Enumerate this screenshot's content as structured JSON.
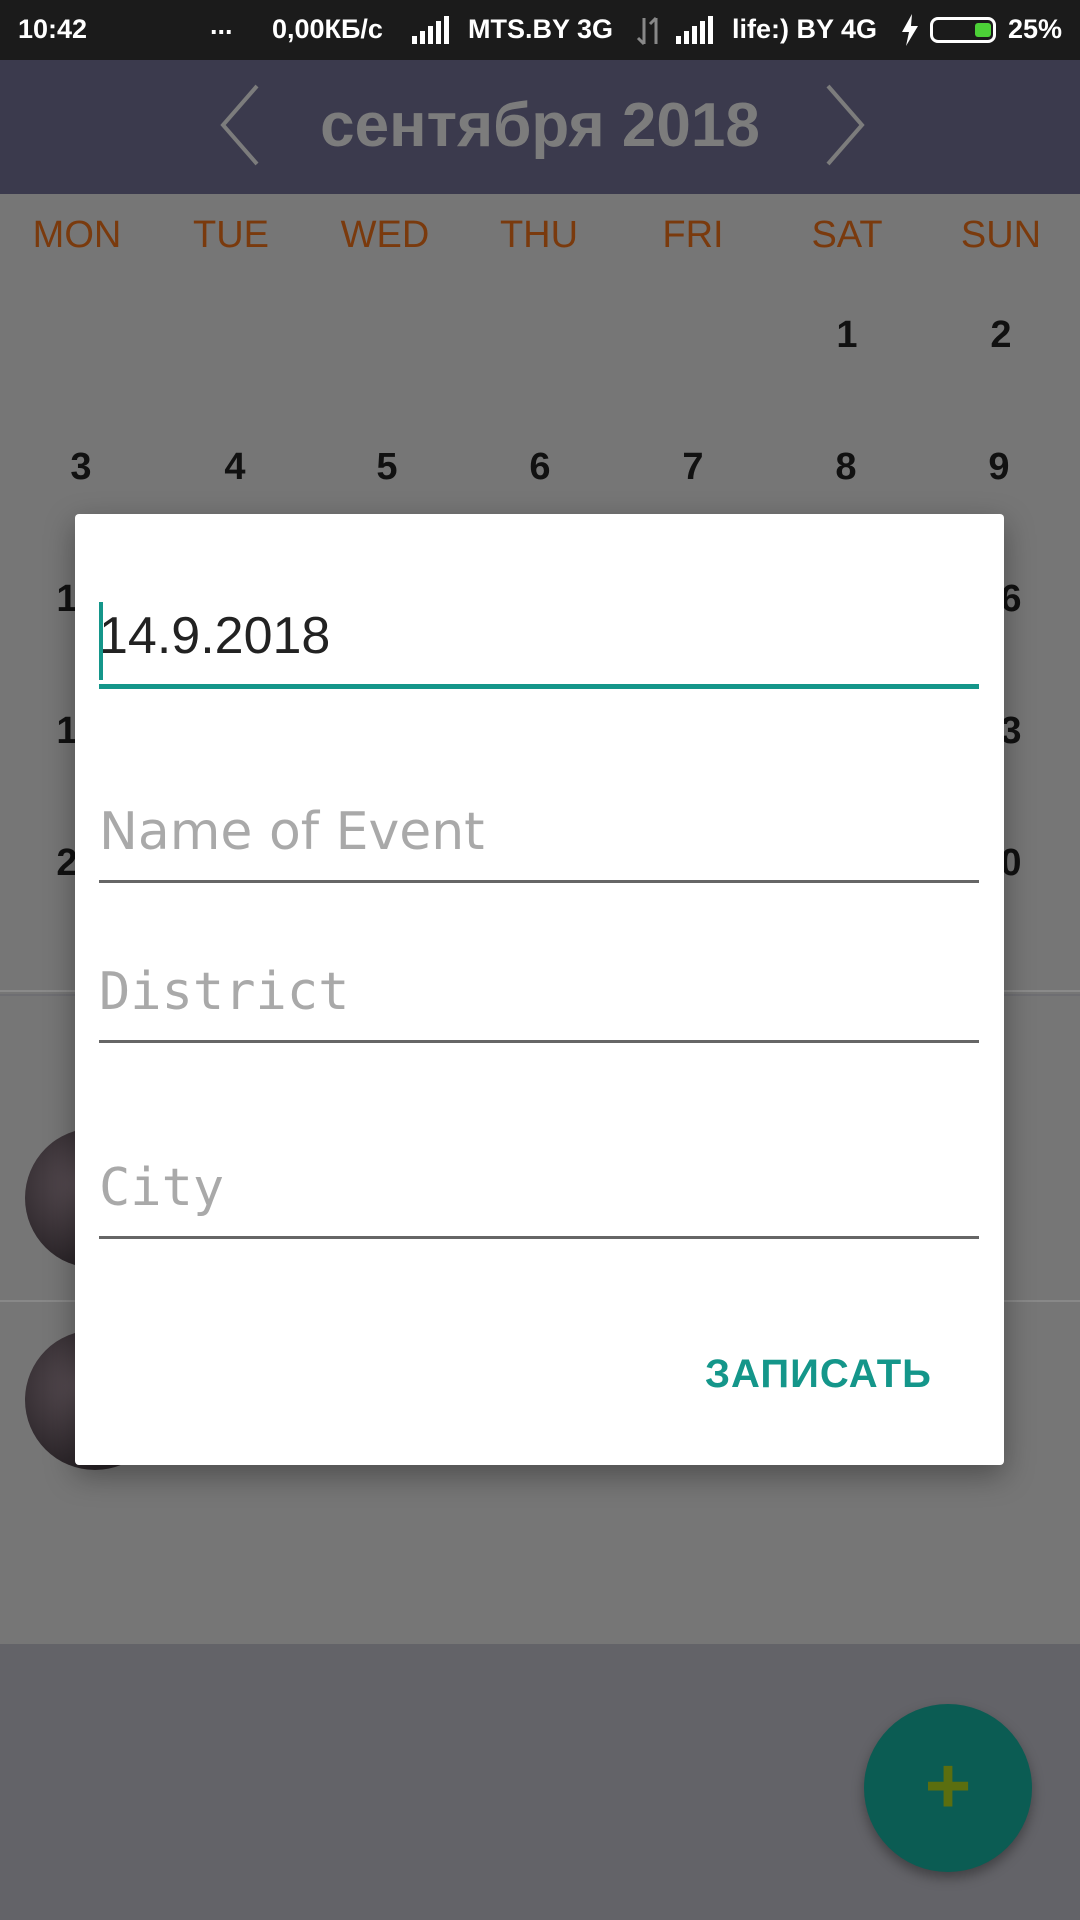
{
  "status_bar": {
    "time": "10:42",
    "dots": "...",
    "speed": "0,00КБ/с",
    "carrier1": "MTS.BY 3G",
    "carrier2": "life:) BY 4G",
    "battery": "25%"
  },
  "calendar": {
    "month_title": "сентября 2018",
    "weekdays": [
      "MON",
      "TUE",
      "WED",
      "THU",
      "FRI",
      "SAT",
      "SUN"
    ],
    "week1": [
      "1",
      "2"
    ],
    "week2": [
      "3",
      "4",
      "5",
      "6",
      "7",
      "8",
      "9"
    ],
    "partial_days": [
      "1",
      "6",
      "1",
      "3",
      "2",
      "0"
    ]
  },
  "dialog": {
    "date_value": "14.9.2018",
    "name_placeholder": "Name of Event",
    "district_placeholder": "District",
    "city_placeholder": "City",
    "save_label": "ЗАПИСАТЬ"
  },
  "fab": {
    "label": "+"
  },
  "colors": {
    "accent": "#14968a",
    "weekday": "#7a3a0d",
    "fab": "#0b5c53"
  }
}
